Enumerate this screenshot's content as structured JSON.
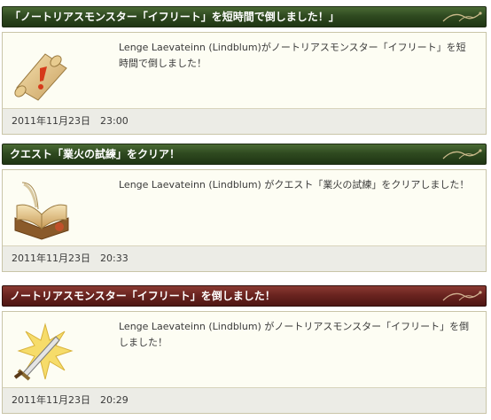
{
  "entries": [
    {
      "title": "「ノートリアスモンスター「イフリート」を短時間で倒しました！」",
      "message": "Lenge Laevateinn (Lindblum)がノートリアスモンスター「イフリート」を短時間で倒しました！",
      "timestamp": "2011年11月23日　23:00",
      "icon": "scroll-exclamation-icon",
      "header_color": "#2f4a20"
    },
    {
      "title": "クエスト「業火の試練」をクリア！",
      "message": "Lenge Laevateinn (Lindblum) がクエスト「業火の試練」をクリアしました！",
      "timestamp": "2011年11月23日　20:33",
      "icon": "open-book-quill-icon",
      "header_color": "#2f4a20"
    },
    {
      "title": "ノートリアスモンスター「イフリート」を倒しました！",
      "message": "Lenge Laevateinn (Lindblum) がノートリアスモンスター「イフリート」を倒しました！",
      "timestamp": "2011年11月23日　20:29",
      "icon": "sword-burst-icon",
      "header_color": "#6a2420"
    }
  ]
}
